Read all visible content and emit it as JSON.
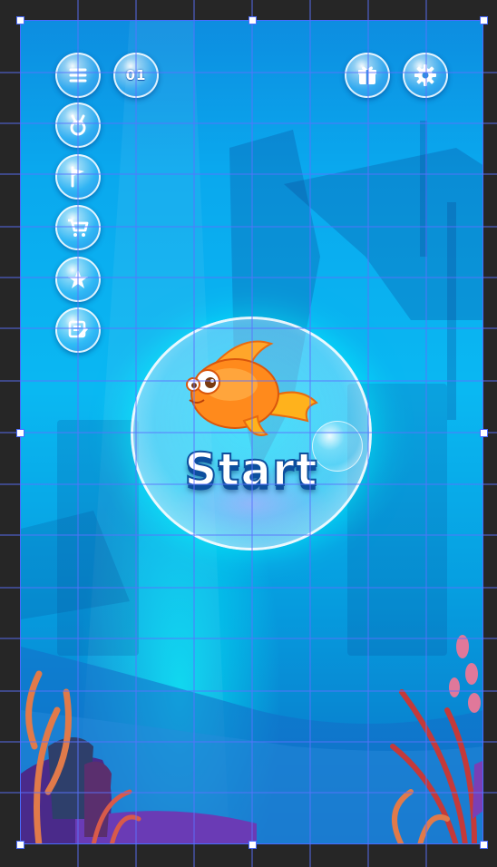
{
  "hud": {
    "level_number": "01",
    "left_icons": [
      "menu-icon",
      "medal-icon",
      "flag-icon",
      "cart-icon",
      "star-icon",
      "notes-icon"
    ],
    "right_icons": [
      "gift-icon",
      "gear-icon"
    ]
  },
  "start_button": {
    "label": "Start"
  },
  "colors": {
    "water_top": "#0d8de0",
    "water_mid": "#0ab8f2",
    "water_bottom": "#0b6fc4",
    "glow": "#00f5ff",
    "text_stroke": "#0d4f9e",
    "fish_orange": "#ff8a1c",
    "grid_line": "#4a6cff"
  }
}
